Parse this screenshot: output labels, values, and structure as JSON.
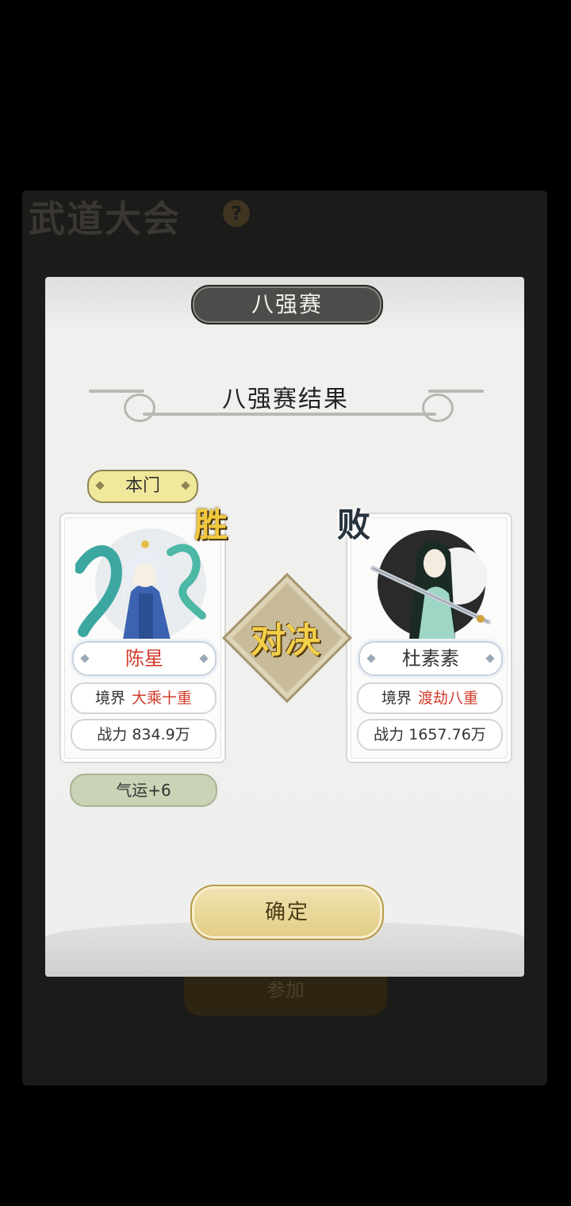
{
  "background": {
    "title": "武道大会",
    "help_icon": "?",
    "join_button": "参加"
  },
  "dialog": {
    "tab_title": "八强赛",
    "result_title": "八强赛结果",
    "vs_text": "对决",
    "confirm_button": "确定",
    "left": {
      "sect_tag": "本门",
      "result_mark": "胜",
      "name": "陈星",
      "realm_label": "境界",
      "realm_value": "大乘十重",
      "power_label": "战力",
      "power_value": "834.9万",
      "luck": "气运+6"
    },
    "right": {
      "result_mark": "败",
      "name": "杜素素",
      "realm_label": "境界",
      "realm_value": "渡劫八重",
      "power_label": "战力",
      "power_value": "1657.76万"
    }
  },
  "colors": {
    "win_gold": "#f1c83e",
    "realm_red": "#d23a2a",
    "confirm_gold": "#e2cd83"
  }
}
